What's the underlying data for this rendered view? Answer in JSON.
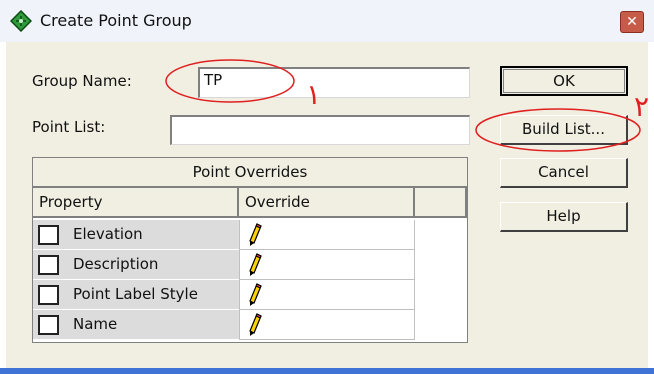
{
  "window": {
    "title": "Create Point Group",
    "close_glyph": "✕"
  },
  "form": {
    "group_name_label": "Group Name:",
    "group_name_value": "TP",
    "point_list_label": "Point List:",
    "point_list_value": ""
  },
  "buttons": {
    "ok": "OK",
    "build_list": "Build List...",
    "cancel": "Cancel",
    "help": "Help"
  },
  "overrides": {
    "title": "Point Overrides",
    "columns": [
      "Property",
      "Override",
      ""
    ],
    "rows": [
      {
        "property": "Elevation",
        "checked": false
      },
      {
        "property": "Description",
        "checked": false
      },
      {
        "property": "Point Label Style",
        "checked": false
      },
      {
        "property": "Name",
        "checked": false
      }
    ]
  },
  "annotations": {
    "mark_1": "١",
    "mark_2": "٢",
    "color": "#e02020"
  },
  "icons": {
    "title": "green-diamond-icon",
    "override": "pencil-icon"
  },
  "colors": {
    "dialog_bg": "#f1efe2",
    "title_bg": "#f0f4fa",
    "close_bg": "#c65b4a",
    "frame_blue": "#3f74d6"
  }
}
